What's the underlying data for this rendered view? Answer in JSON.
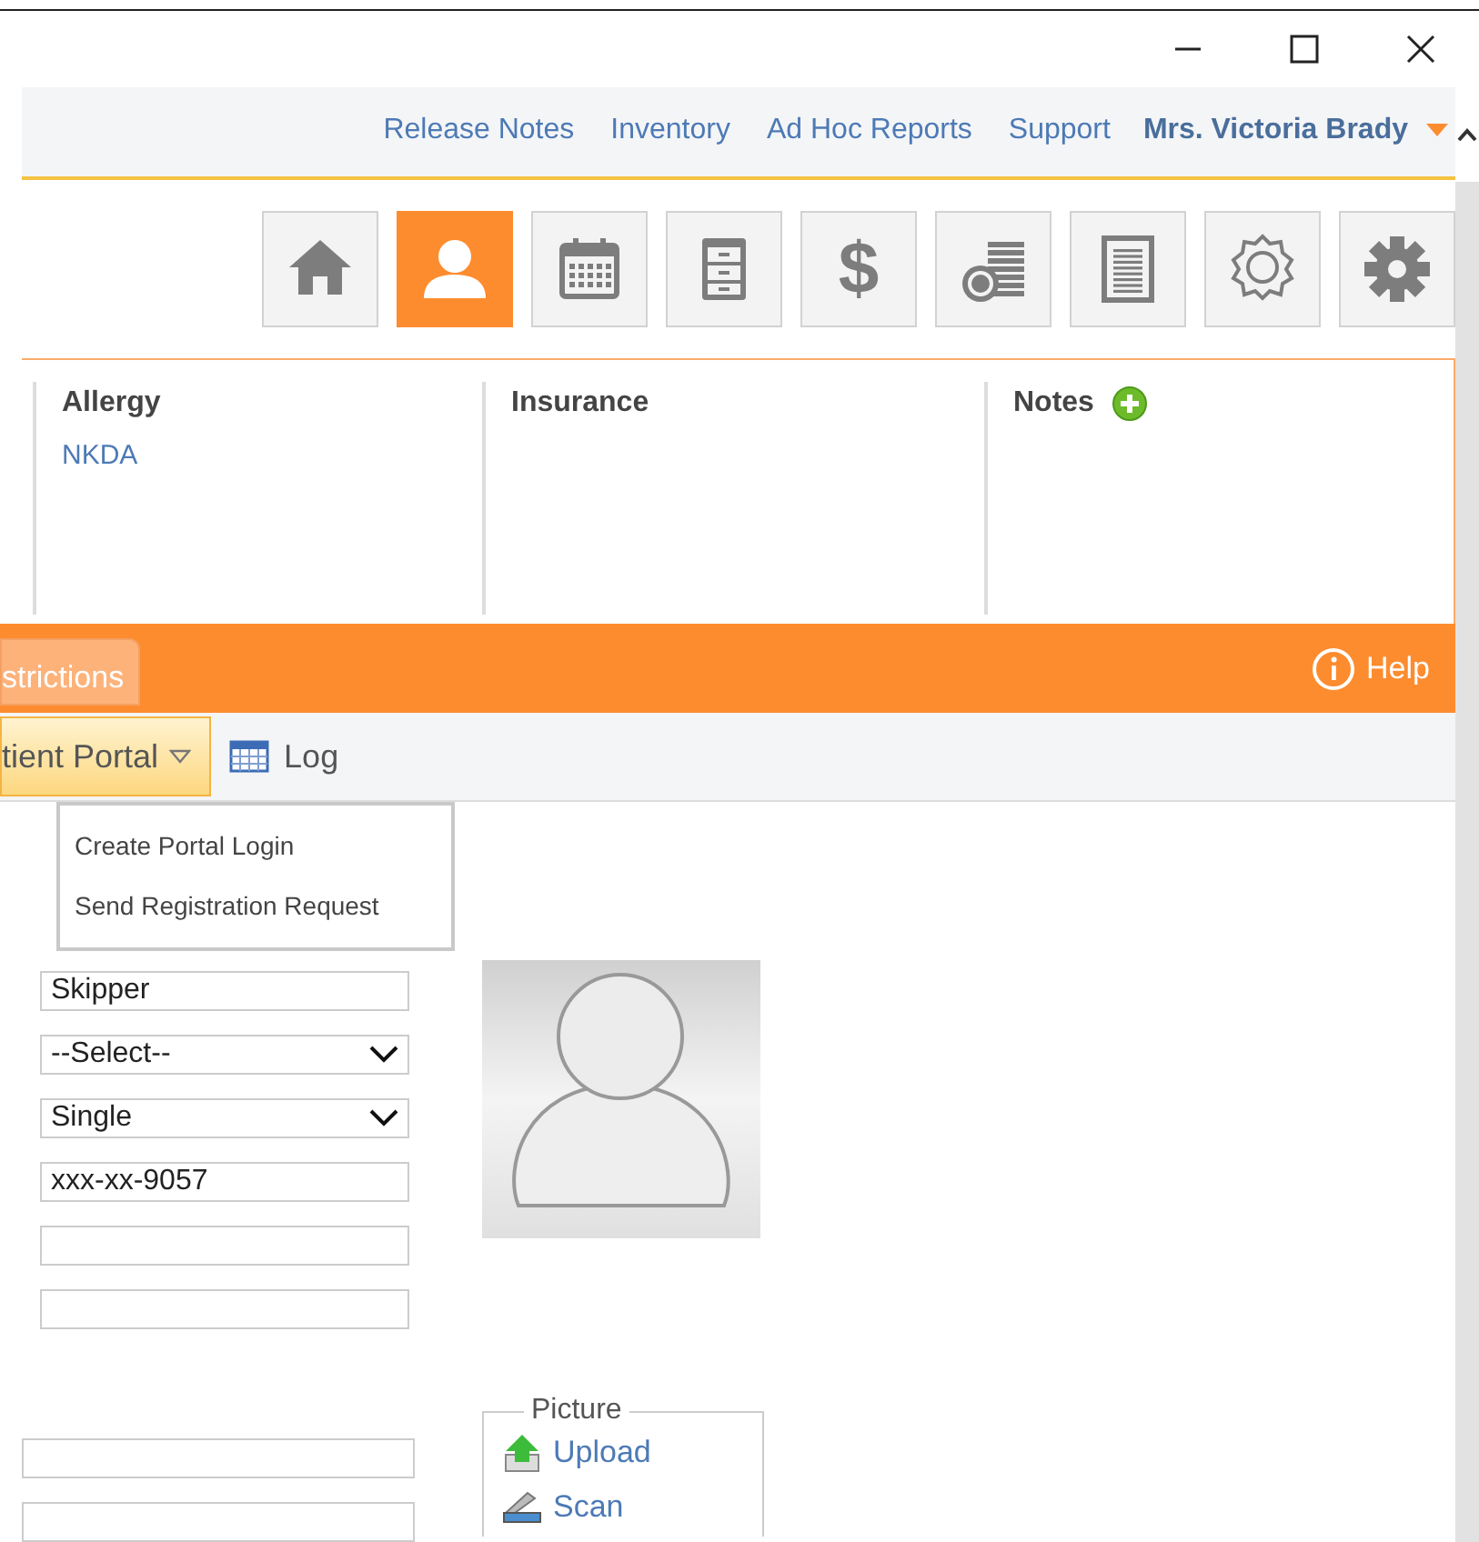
{
  "nav_links": [
    {
      "label": "Release Notes"
    },
    {
      "label": "Inventory"
    },
    {
      "label": "Ad Hoc Reports"
    },
    {
      "label": "Support"
    }
  ],
  "user_menu": {
    "label": "Mrs. Victoria Brady"
  },
  "toolbar": [
    {
      "kind": "home",
      "selected": false
    },
    {
      "kind": "person",
      "selected": true
    },
    {
      "kind": "calendar",
      "selected": false
    },
    {
      "kind": "cabinet",
      "selected": false
    },
    {
      "kind": "dollar",
      "glyph": "$",
      "selected": false
    },
    {
      "kind": "coins",
      "selected": false
    },
    {
      "kind": "document",
      "selected": false
    },
    {
      "kind": "award",
      "selected": false
    },
    {
      "kind": "gear",
      "selected": false
    }
  ],
  "summary": [
    {
      "heading": "Allergy",
      "value": "NKDA",
      "add_button": false
    },
    {
      "heading": "Insurance",
      "add_button": false
    },
    {
      "heading": "Notes",
      "add_button": true
    }
  ],
  "tab_band": {
    "tabs": [
      {
        "label": "strictions",
        "selected": false
      }
    ],
    "help": "Help"
  },
  "subtoolbar": {
    "portal_button": "tient Portal",
    "expanded": true,
    "log": "Log"
  },
  "portal_menu": [
    "Create Portal Login",
    "Send Registration Request"
  ],
  "fields": [
    {
      "kind": "text",
      "value": "Skipper"
    },
    {
      "kind": "select",
      "value": "--Select--"
    },
    {
      "kind": "select",
      "value": "Single"
    },
    {
      "kind": "text",
      "value": "xxx-xx-9057"
    },
    {
      "kind": "text"
    },
    {
      "kind": "text"
    }
  ],
  "lower_fields": [
    {
      "kind": "text"
    },
    {
      "kind": "text"
    }
  ],
  "picture_box": {
    "legend": "Picture",
    "actions": [
      {
        "kind": "upload",
        "label": "Upload"
      },
      {
        "kind": "scan",
        "label": "Scan"
      }
    ]
  }
}
